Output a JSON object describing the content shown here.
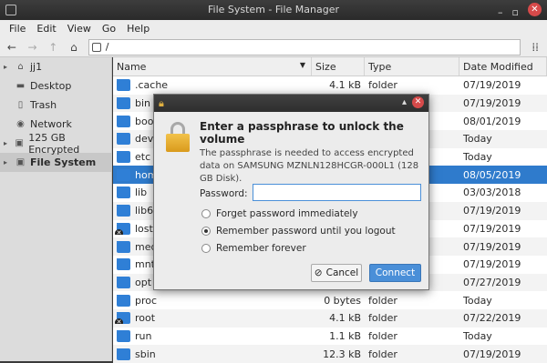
{
  "window": {
    "title": "File System - File Manager"
  },
  "menu": [
    "File",
    "Edit",
    "View",
    "Go",
    "Help"
  ],
  "location": {
    "path": "/"
  },
  "sidebar": [
    {
      "label": "jj1",
      "arrow": "▸"
    },
    {
      "label": "Desktop",
      "arrow": ""
    },
    {
      "label": "Trash",
      "arrow": ""
    },
    {
      "label": "Network",
      "arrow": ""
    },
    {
      "label": "125 GB Encrypted",
      "arrow": "▸"
    },
    {
      "label": "File System",
      "arrow": "▸"
    }
  ],
  "columns": {
    "name": "Name",
    "size": "Size",
    "type": "Type",
    "date": "Date Modified"
  },
  "files": [
    {
      "name": ".cache",
      "size": "4.1 kB",
      "type": "folder",
      "date": "07/19/2019",
      "locked": false,
      "selected": false
    },
    {
      "name": "bin",
      "size": "",
      "type": "",
      "date": "07/19/2019",
      "locked": false,
      "selected": false
    },
    {
      "name": "boot",
      "size": "",
      "type": "",
      "date": "08/01/2019",
      "locked": false,
      "selected": false
    },
    {
      "name": "dev",
      "size": "",
      "type": "",
      "date": "Today",
      "locked": false,
      "selected": false
    },
    {
      "name": "etc",
      "size": "",
      "type": "",
      "date": "Today",
      "locked": false,
      "selected": false
    },
    {
      "name": "home",
      "size": "",
      "type": "",
      "date": "08/05/2019",
      "locked": false,
      "selected": true
    },
    {
      "name": "lib",
      "size": "",
      "type": "",
      "date": "03/03/2018",
      "locked": false,
      "selected": false
    },
    {
      "name": "lib64",
      "size": "",
      "type": "",
      "date": "07/19/2019",
      "locked": false,
      "selected": false
    },
    {
      "name": "lost+found",
      "size": "",
      "type": "",
      "date": "07/19/2019",
      "locked": true,
      "selected": false
    },
    {
      "name": "media",
      "size": "",
      "type": "",
      "date": "07/19/2019",
      "locked": false,
      "selected": false
    },
    {
      "name": "mnt",
      "size": "",
      "type": "",
      "date": "07/19/2019",
      "locked": false,
      "selected": false
    },
    {
      "name": "opt",
      "size": "",
      "type": "",
      "date": "07/27/2019",
      "locked": false,
      "selected": false
    },
    {
      "name": "proc",
      "size": "0 bytes",
      "type": "folder",
      "date": "Today",
      "locked": false,
      "selected": false
    },
    {
      "name": "root",
      "size": "4.1 kB",
      "type": "folder",
      "date": "07/22/2019",
      "locked": true,
      "selected": false
    },
    {
      "name": "run",
      "size": "1.1 kB",
      "type": "folder",
      "date": "Today",
      "locked": false,
      "selected": false
    },
    {
      "name": "sbin",
      "size": "12.3 kB",
      "type": "folder",
      "date": "07/19/2019",
      "locked": false,
      "selected": false
    }
  ],
  "dialog": {
    "heading": "Enter a passphrase to unlock the volume",
    "description": "The passphrase is needed to access encrypted data on SAMSUNG MZNLN128HCGR-000L1 (128 GB Disk).",
    "password_label": "Password:",
    "password_value": "",
    "options": [
      {
        "label": "Forget password immediately",
        "checked": false
      },
      {
        "label": "Remember password until you logout",
        "checked": true
      },
      {
        "label": "Remember forever",
        "checked": false
      }
    ],
    "cancel_label": "Cancel",
    "connect_label": "Connect"
  },
  "colors": {
    "accent": "#2f7bcc",
    "button": "#4a8fd8",
    "lock": "#e0a93a"
  }
}
